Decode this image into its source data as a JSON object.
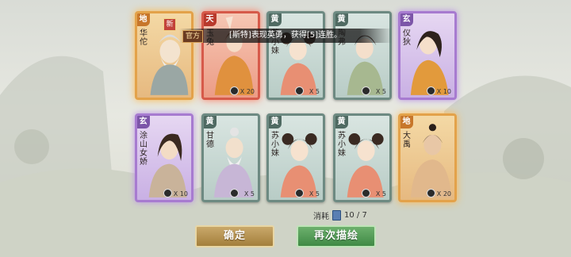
{
  "toast": {
    "tag": "官方",
    "message": "[斯特]表现英勇，获得[5]连胜。"
  },
  "cards": [
    {
      "tier": "地",
      "name": "华佗",
      "is_new": true,
      "new_label": "新",
      "count": ""
    },
    {
      "tier": "天",
      "name": "玉兔",
      "is_new": false,
      "count": "X 20"
    },
    {
      "tier": "黄",
      "name": "苏小妹",
      "is_new": false,
      "count": "X 5"
    },
    {
      "tier": "黄",
      "name": "陶弗",
      "is_new": false,
      "count": "X 5"
    },
    {
      "tier": "玄",
      "name": "仪狄",
      "is_new": false,
      "count": "X 10"
    },
    {
      "tier": "玄",
      "name": "涂山女娇",
      "is_new": false,
      "count": "X 10"
    },
    {
      "tier": "黄",
      "name": "甘德",
      "is_new": false,
      "count": "X 5"
    },
    {
      "tier": "黄",
      "name": "苏小妹",
      "is_new": false,
      "count": "X 5"
    },
    {
      "tier": "黄",
      "name": "苏小妹",
      "is_new": false,
      "count": "X 5"
    },
    {
      "tier": "地",
      "name": "大禹",
      "is_new": false,
      "count": "X 20"
    }
  ],
  "consume": {
    "label": "消耗",
    "value": "10 / 7"
  },
  "buttons": {
    "confirm": "确定",
    "draw_again": "再次描绘"
  }
}
